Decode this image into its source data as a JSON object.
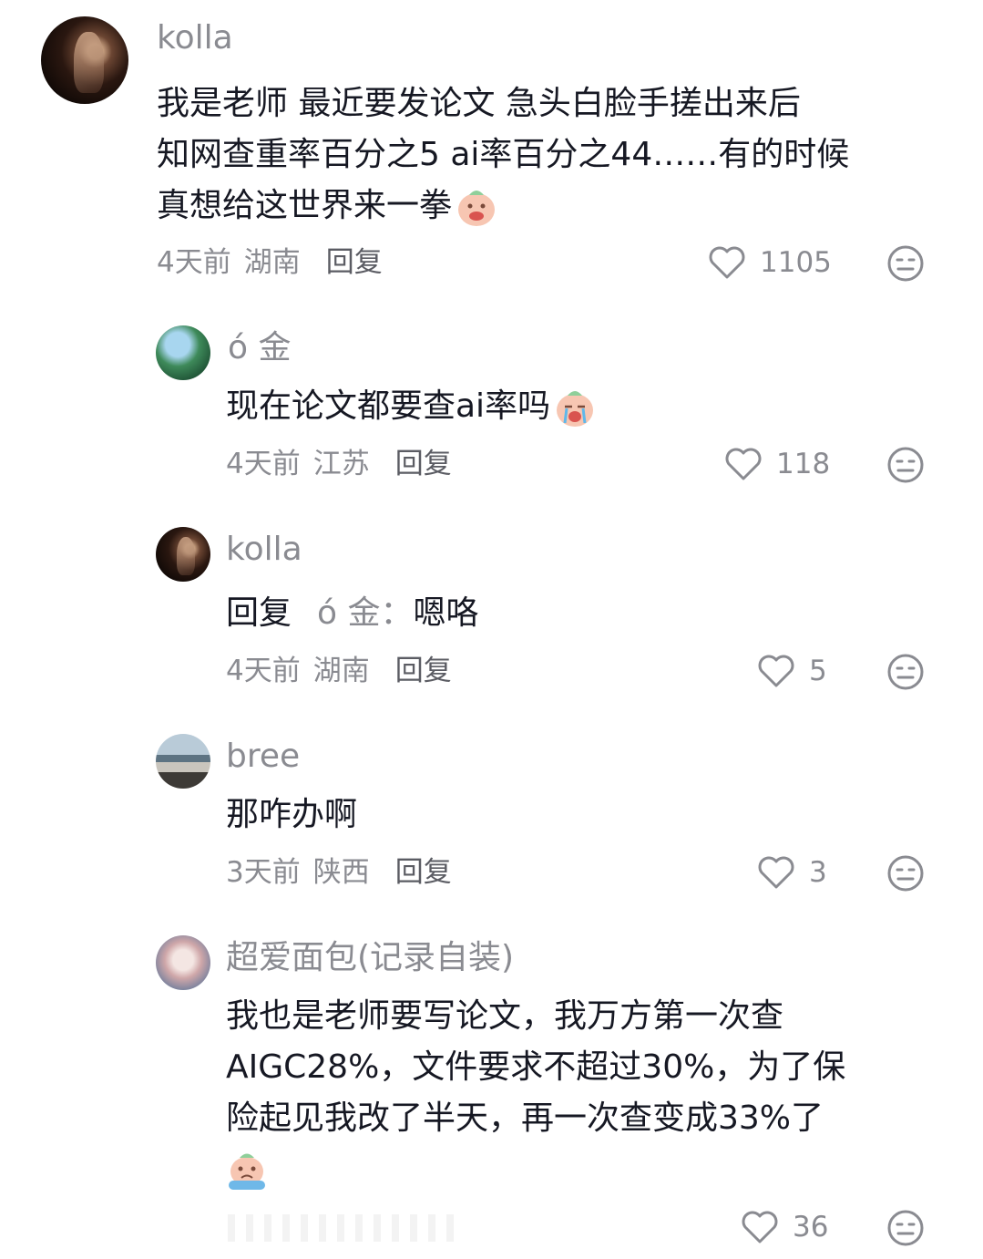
{
  "comments": [
    {
      "user": "kolla",
      "lines": [
        "我是老师 最近要发论文 急头白脸手搓出来后",
        "知网查重率百分之5 ai率百分之44……有的时候",
        "真想给这世界来一拳"
      ],
      "time": "4天前",
      "location": "湖南",
      "reply_label": "回复",
      "likes": "1105"
    },
    {
      "user": "ó 金",
      "lines": [
        "现在论文都要查ai率吗"
      ],
      "time": "4天前",
      "location": "江苏",
      "reply_label": "回复",
      "likes": "118"
    },
    {
      "user": "kolla",
      "reply_prefix": "回复",
      "reply_to": "ó 金：",
      "text": "嗯咯",
      "time": "4天前",
      "location": "湖南",
      "reply_label": "回复",
      "likes": "5"
    },
    {
      "user": "bree",
      "lines": [
        "那咋办啊"
      ],
      "time": "3天前",
      "location": "陕西",
      "reply_label": "回复",
      "likes": "3"
    },
    {
      "user": "超爱面包(记录自装)",
      "lines": [
        "我也是老师要写论文，我万方第一次查",
        "AIGC28%，文件要求不超过30%，为了保",
        "险起见我改了半天，再一次查变成33%了"
      ],
      "likes": "36"
    }
  ],
  "icons": {
    "like": "heart-outline-icon",
    "dislike": "neutral-face-icon",
    "emoji_1": "tired-face-emoji",
    "emoji_2": "crying-face-emoji",
    "emoji_3": "sad-face-emoji"
  }
}
